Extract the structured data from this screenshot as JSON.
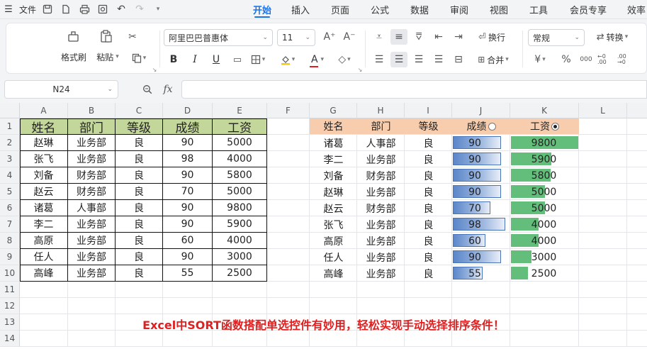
{
  "menubar": {
    "file_label": "文件",
    "tabs": [
      "开始",
      "插入",
      "页面",
      "公式",
      "数据",
      "审阅",
      "视图",
      "工具",
      "会员专享",
      "效率"
    ],
    "active_tab": "开始"
  },
  "ribbon": {
    "format_painter": "格式刷",
    "paste": "粘贴",
    "font_name": "阿里巴巴普惠体",
    "font_size": "11",
    "wrap_text": "换行",
    "merge": "合并",
    "number_format": "常规",
    "convert": "转换",
    "bold": "B",
    "italic": "I",
    "underline": "U",
    "font_color_glyph": "A",
    "increase_font": "A⁺",
    "decrease_font": "A⁻",
    "currency": "¥",
    "percent": "%",
    "thousands": "000",
    "inc_decimal": "←0 .00",
    "dec_decimal": ".00 →0"
  },
  "formula_bar": {
    "cell_ref": "N24",
    "fx": "fx",
    "formula": ""
  },
  "columns": [
    "A",
    "B",
    "C",
    "D",
    "E",
    "F",
    "G",
    "H",
    "I",
    "J",
    "K",
    "L"
  ],
  "rows": [
    "1",
    "2",
    "3",
    "4",
    "5",
    "6",
    "7",
    "8",
    "9",
    "10",
    "11",
    "12",
    "13",
    "14"
  ],
  "left_table": {
    "headers": [
      "姓名",
      "部门",
      "等级",
      "成绩",
      "工资"
    ],
    "rows": [
      [
        "赵琳",
        "业务部",
        "良",
        "90",
        "5000"
      ],
      [
        "张飞",
        "业务部",
        "良",
        "98",
        "4000"
      ],
      [
        "刘备",
        "财务部",
        "良",
        "90",
        "5800"
      ],
      [
        "赵云",
        "财务部",
        "良",
        "70",
        "5000"
      ],
      [
        "诸葛",
        "人事部",
        "良",
        "90",
        "9800"
      ],
      [
        "李二",
        "业务部",
        "良",
        "90",
        "5900"
      ],
      [
        "高原",
        "业务部",
        "良",
        "60",
        "4000"
      ],
      [
        "任人",
        "业务部",
        "良",
        "90",
        "3000"
      ],
      [
        "高峰",
        "业务部",
        "良",
        "55",
        "2500"
      ]
    ]
  },
  "right_table": {
    "headers": [
      "姓名",
      "部门",
      "等级",
      "成绩",
      "工资"
    ],
    "score_radio_selected": false,
    "salary_radio_selected": true,
    "rows": [
      [
        "诸葛",
        "人事部",
        "良",
        "90",
        "9800"
      ],
      [
        "李二",
        "业务部",
        "良",
        "90",
        "5900"
      ],
      [
        "刘备",
        "财务部",
        "良",
        "90",
        "5800"
      ],
      [
        "赵琳",
        "业务部",
        "良",
        "90",
        "5000"
      ],
      [
        "赵云",
        "财务部",
        "良",
        "70",
        "5000"
      ],
      [
        "张飞",
        "业务部",
        "良",
        "98",
        "4000"
      ],
      [
        "高原",
        "业务部",
        "良",
        "60",
        "4000"
      ],
      [
        "任人",
        "业务部",
        "良",
        "90",
        "3000"
      ],
      [
        "高峰",
        "业务部",
        "良",
        "55",
        "2500"
      ]
    ],
    "score_bar_max": 100,
    "salary_bar_max": 9800
  },
  "caption": "Excel中SORT函数搭配单选控件有妙用，轻松实现手动选择排序条件！",
  "colors": {
    "left_header_bg": "#c4d79b",
    "right_header_bg": "#f7cdad",
    "score_bar": "#5b86c9",
    "salary_bar": "#63be7b",
    "caption": "#e02020",
    "accent": "#1a73e8"
  }
}
